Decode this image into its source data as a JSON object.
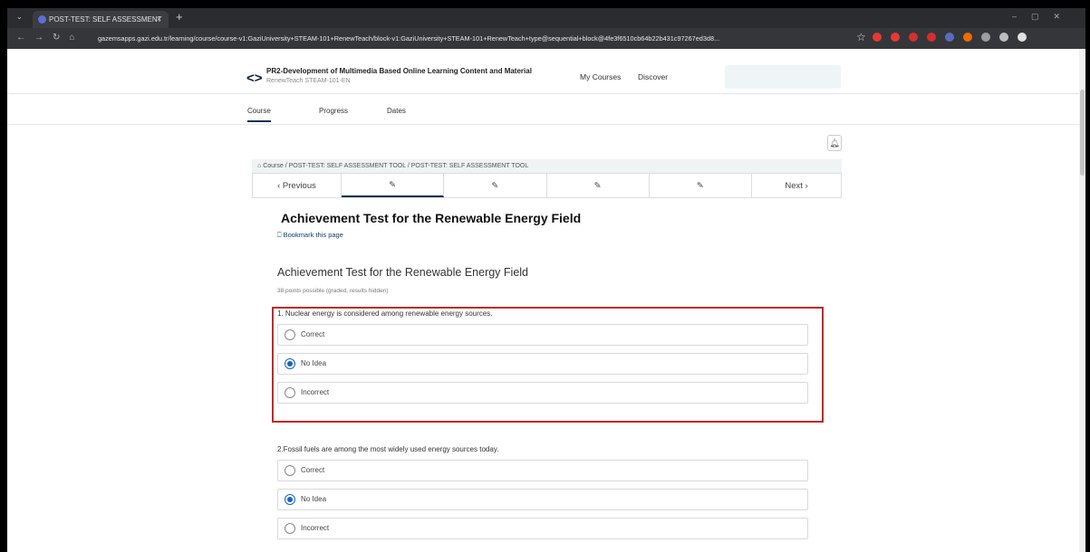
{
  "browser": {
    "tab_title": "POST-TEST: SELF ASSESSMENT",
    "tab_close": "×",
    "new_tab": "+",
    "url": "gazemsapps.gazi.edu.tr/learning/course/course-v1:GaziUniversity+STEAM-101+RenewTeach/block-v1:GaziUniversity+STEAM-101+RenewTeach+type@sequential+block@4fe3f6510cb64b22b431c97267ed3d8..."
  },
  "header": {
    "logo": "<>",
    "course_title": "PR2-Development of Multimedia Based Online Learning Content and Material",
    "course_subtitle": "RenewTeach STEAM-101-EN",
    "nav_my_courses": "My Courses",
    "nav_discover": "Discover"
  },
  "course_tabs": [
    "Course",
    "Progress",
    "Dates"
  ],
  "breadcrumb": "Course  /  POST-TEST: SELF ASSESSMENT TOOL  /  POST-TEST: SELF ASSESSMENT TOOL",
  "sequence_nav": {
    "previous": "‹  Previous",
    "next": "Next  ›",
    "unit_icon": "✎"
  },
  "unit": {
    "title": "Achievement Test for the Renewable Energy Field",
    "bookmark": "Bookmark this page"
  },
  "problem": {
    "title": "Achievement Test for the Renewable Energy Field",
    "points": "38 points possible (graded, results hidden)"
  },
  "questions": [
    {
      "text": "1. Nuclear energy is considered among renewable energy sources.",
      "choices": [
        {
          "label": "Correct",
          "selected": false
        },
        {
          "label": "No Idea",
          "selected": true
        },
        {
          "label": "Incorrect",
          "selected": false
        }
      ]
    },
    {
      "text": "2.Fossil fuels are among the most widely used energy sources today.",
      "choices": [
        {
          "label": "Correct",
          "selected": false
        },
        {
          "label": "No Idea",
          "selected": true
        },
        {
          "label": "Incorrect",
          "selected": false
        }
      ]
    }
  ],
  "colors": {
    "highlight": "#c62828",
    "radio_selected": "#1565c0",
    "brand_dark": "#0a3055"
  }
}
